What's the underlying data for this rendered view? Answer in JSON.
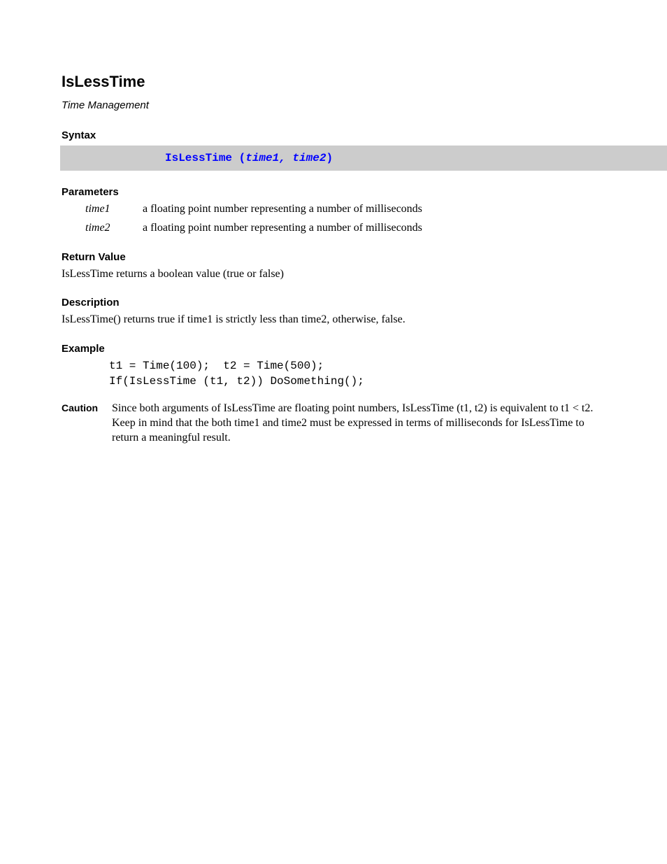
{
  "title": "IsLessTime",
  "subtitle": "Time Management",
  "syntax_heading": "Syntax",
  "syntax_fn": "IsLessTime (",
  "syntax_params": "time1, time2",
  "syntax_close": ")",
  "params_heading": "Parameters",
  "params": [
    {
      "name": "time1",
      "desc": "a floating point number representing a number of milliseconds"
    },
    {
      "name": "time2",
      "desc": "a floating point number representing a number of milliseconds"
    }
  ],
  "return_heading": "Return Value",
  "return_text": "IsLessTime returns a boolean value (true or false)",
  "description_heading": "Description",
  "description_text": "IsLessTime() returns true if time1 is strictly less than time2, otherwise, false.",
  "example_heading": "Example",
  "example_code": "t1 = Time(100);  t2 = Time(500);\nIf(IsLessTime (t1, t2)) DoSomething();",
  "caution_label": "Caution",
  "caution_text": "Since both arguments of IsLessTime are floating point numbers, IsLessTime (t1, t2) is equivalent to t1 < t2. Keep in mind that the both time1 and time2 must be expressed in terms of milliseconds for IsLessTime to return a meaningful result."
}
